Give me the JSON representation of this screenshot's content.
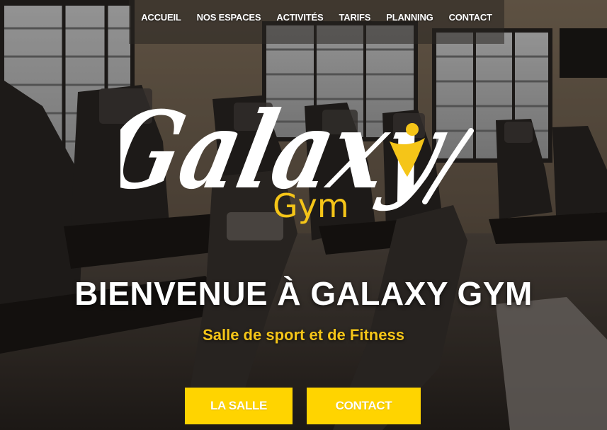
{
  "nav": {
    "items": [
      {
        "label": "ACCUEIL"
      },
      {
        "label": "NOS ESPACES"
      },
      {
        "label": "ACTIVITÉS"
      },
      {
        "label": "TARIFS"
      },
      {
        "label": "PLANNING"
      },
      {
        "label": "CONTACT"
      }
    ]
  },
  "logo": {
    "text": "Galaxy",
    "subtext": "Gym"
  },
  "hero": {
    "title": "BIENVENUE À GALAXY GYM",
    "subtitle": "Salle de sport et de Fitness"
  },
  "buttons": {
    "salle_label": "LA SALLE",
    "contact_label": "CONTACT"
  },
  "colors": {
    "accent": "#ffd400",
    "subtitle": "#f5c518",
    "text": "#ffffff"
  },
  "icons": {
    "logo_figure": "person-figure-icon"
  }
}
